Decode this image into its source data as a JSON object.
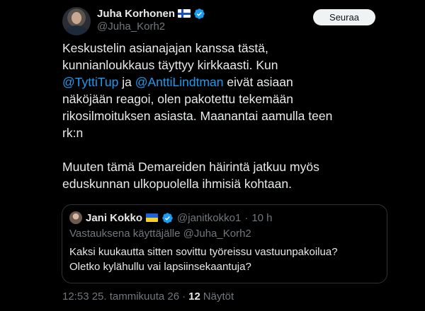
{
  "author": {
    "display_name": "Juha Korhonen",
    "flag_icon": "finland-flag-icon",
    "verified_icon": "verified-badge-icon",
    "handle": "@Juha_Korh2"
  },
  "follow_label": "Seuraa",
  "body": {
    "line1": "Keskustelin asianajajan kanssa tästä,",
    "line2": "kunnianloukkaus täyttyy kirkkaasti. Kun",
    "line3_mention1": "@TyttiTup",
    "line3_mid": " ja ",
    "line3_mention2": "@AnttiLindtman",
    "line3_end": " eivät asiaan",
    "line4": "näköjään reagoi, olen pakotettu tekemään",
    "line5": "rikosilmoituksen asiasta. Maanantai aamulla teen",
    "line6": "rk:n",
    "line7": "Muuten tämä Demareiden häirintä jatkuu myös",
    "line8": "eduskunnan ulkopuolella ihmisiä kohtaan."
  },
  "quoted": {
    "display_name": "Jani Kokko",
    "flag_icon": "ukraine-flag-icon",
    "verified_icon": "verified-badge-icon",
    "handle": "@janitkokko1",
    "separator": "·",
    "time": "10 h",
    "reply_context": "Vastauksena käyttäjälle @Juha_Korh2",
    "text_line1": "Kaksi kuukautta sitten sovittu työreissu vastuunpakoilua?",
    "text_line2": "Oletko kylähullu vai lapsiinsekaantuja?"
  },
  "footer": {
    "timestamp": "12:53 25. tammikuuta 26",
    "separator": "·",
    "views_count": "12",
    "views_label": "Näytöt"
  },
  "colors": {
    "background": "#000000",
    "text": "#e7e9ea",
    "secondary": "#71767b",
    "link": "#1d9bf0",
    "border": "#2f3336",
    "verified": "#1d9bf0"
  }
}
